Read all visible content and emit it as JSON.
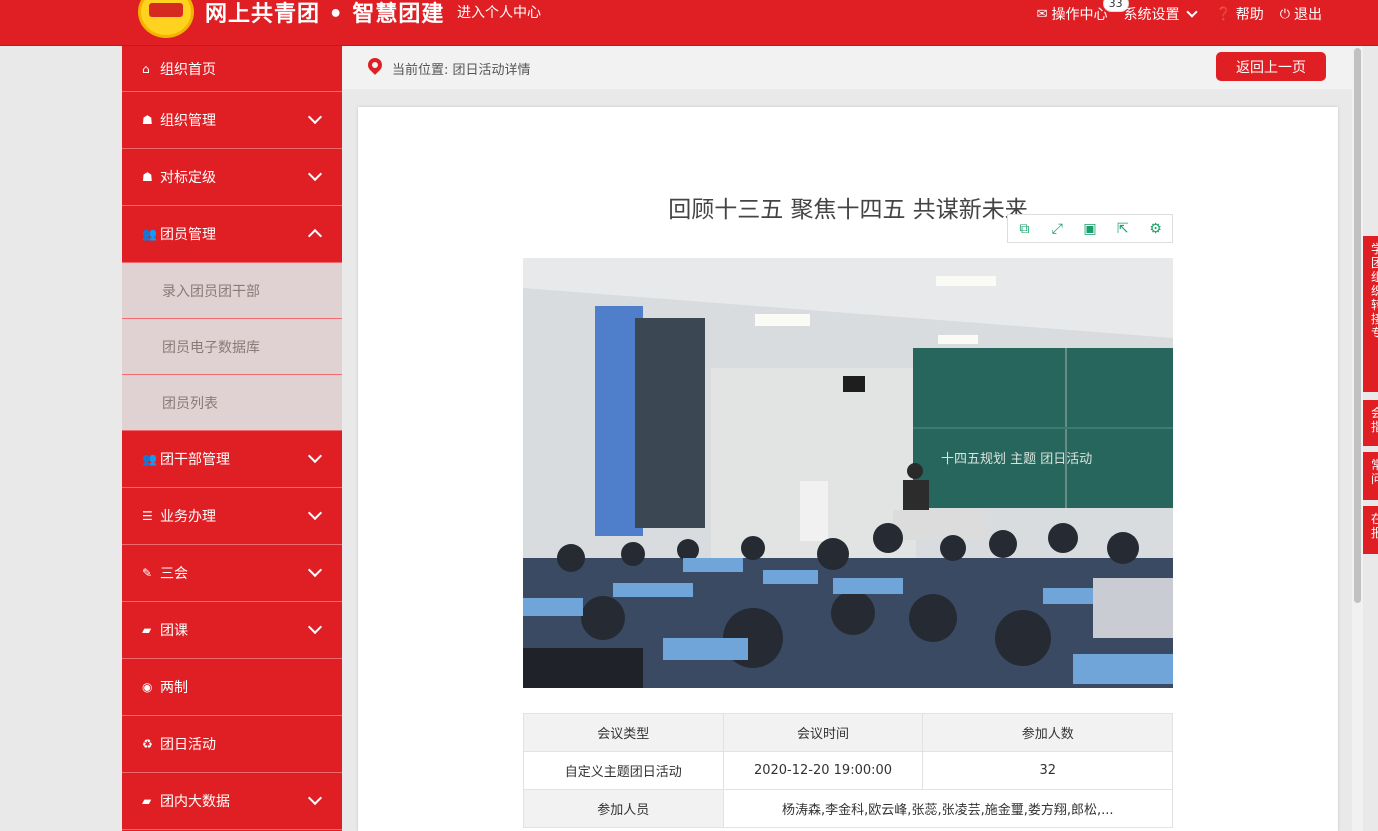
{
  "header": {
    "site_title": "网上共青团 • 智慧团建",
    "personal_center": "进入个人中心",
    "nav": {
      "ops_center": "操作中心",
      "ops_badge": "33",
      "settings": "系统设置",
      "help": "帮助",
      "logout": "退出"
    }
  },
  "sidebar": {
    "items": [
      {
        "label": "组织首页",
        "icon": "home-icon"
      },
      {
        "label": "组织管理",
        "icon": "sitemap-icon"
      },
      {
        "label": "对标定级",
        "icon": "sitemap-icon"
      },
      {
        "label": "团员管理",
        "icon": "users-icon"
      },
      {
        "label": "团干部管理",
        "icon": "users-icon"
      },
      {
        "label": "业务办理",
        "icon": "list-icon"
      },
      {
        "label": "三会",
        "icon": "edit-icon"
      },
      {
        "label": "团课",
        "icon": "folder-icon"
      },
      {
        "label": "两制",
        "icon": "circle-dot-icon"
      },
      {
        "label": "团日活动",
        "icon": "recycle-icon"
      },
      {
        "label": "团内大数据",
        "icon": "folder-icon"
      }
    ],
    "submenu": [
      "录入团员团干部",
      "团员电子数据库",
      "团员列表"
    ]
  },
  "breadcrumb": {
    "text": "当前位置: 团日活动详情",
    "back_label": "返回上一页"
  },
  "article": {
    "title": "回顾十三五 聚焦十四五 共谋新未来",
    "toolbar_icons": [
      "copy-icon",
      "fullscreen-icon",
      "save-icon",
      "share-icon",
      "settings-icon"
    ]
  },
  "table": {
    "headers": [
      "会议类型",
      "会议时间",
      "参加人数"
    ],
    "row": [
      "自定义主题团日活动",
      "2020-12-20 19:00:00",
      "32"
    ],
    "participants_label": "参加人员",
    "participants": "杨涛森,李金科,欧云峰,张蕊,张凌芸,施金璽,娄方翔,郎松,..."
  },
  "side_tabs": [
    "学团组织转接专",
    "会指",
    "常问",
    "在报"
  ]
}
